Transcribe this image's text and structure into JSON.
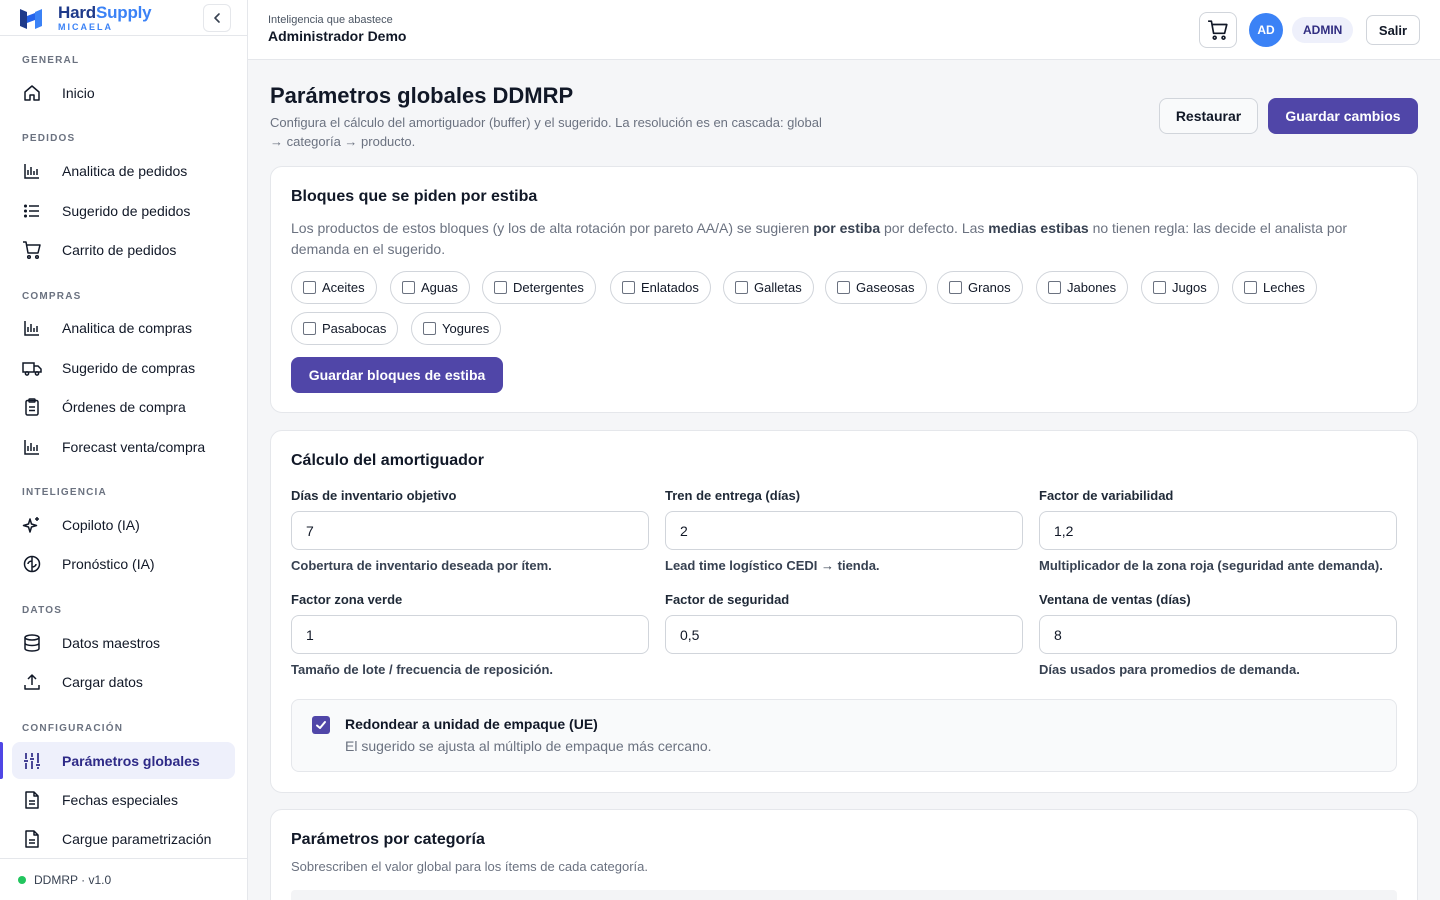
{
  "brand": {
    "name_a": "Hard",
    "name_b": "Supply",
    "sub": "MICAELA"
  },
  "sidebar": {
    "sections": [
      {
        "title": "GENERAL",
        "items": [
          {
            "label": "Inicio",
            "icon": "home-icon"
          }
        ]
      },
      {
        "title": "PEDIDOS",
        "items": [
          {
            "label": "Analitica de pedidos",
            "icon": "bar-chart-icon"
          },
          {
            "label": "Sugerido de pedidos",
            "icon": "list-icon"
          },
          {
            "label": "Carrito de pedidos",
            "icon": "cart-icon"
          }
        ]
      },
      {
        "title": "COMPRAS",
        "items": [
          {
            "label": "Analitica de compras",
            "icon": "bar-chart-icon"
          },
          {
            "label": "Sugerido de compras",
            "icon": "truck-icon"
          },
          {
            "label": "Órdenes de compra",
            "icon": "clipboard-icon"
          },
          {
            "label": "Forecast venta/compra",
            "icon": "bar-chart-icon"
          }
        ]
      },
      {
        "title": "INTELIGENCIA",
        "items": [
          {
            "label": "Copiloto (IA)",
            "icon": "sparkles-icon"
          },
          {
            "label": "Pronóstico (IA)",
            "icon": "brain-icon"
          }
        ]
      },
      {
        "title": "DATOS",
        "items": [
          {
            "label": "Datos maestros",
            "icon": "database-icon"
          },
          {
            "label": "Cargar datos",
            "icon": "upload-icon"
          }
        ]
      },
      {
        "title": "CONFIGURACIÓN",
        "items": [
          {
            "label": "Parámetros globales",
            "icon": "sliders-icon"
          },
          {
            "label": "Fechas especiales",
            "icon": "file-icon"
          },
          {
            "label": "Cargue parametrización",
            "icon": "file-icon"
          }
        ]
      }
    ],
    "footer": "DDMRP · v1.0"
  },
  "header": {
    "tagline": "Inteligencia que abastece",
    "user": "Administrador Demo",
    "avatar": "AD",
    "role": "ADMIN",
    "logout": "Salir"
  },
  "page": {
    "title": "Parámetros globales DDMRP",
    "desc": "Configura el cálculo del amortiguador (buffer) y el sugerido. La resolución es en cascada: global → categoría → producto.",
    "restore": "Restaurar",
    "save": "Guardar cambios"
  },
  "stack_card": {
    "title": "Bloques que se piden por estiba",
    "desc_1": "Los productos de estos bloques (y los de alta rotación por pareto AA/A) se sugieren ",
    "desc_b1": "por estiba",
    "desc_2": " por defecto. Las ",
    "desc_b2": "medias estibas",
    "desc_3": " no tienen regla: las decide el analista por demanda en el sugerido.",
    "blocks": [
      "Aceites",
      "Aguas",
      "Detergentes",
      "Enlatados",
      "Galletas",
      "Gaseosas",
      "Granos",
      "Jabones",
      "Jugos",
      "Leches",
      "Pasabocas",
      "Yogures"
    ],
    "save": "Guardar bloques de estiba"
  },
  "buffer_card": {
    "title": "Cálculo del amortiguador",
    "fields": [
      {
        "label": "Días de inventario objetivo",
        "value": "7",
        "help": "Cobertura de inventario deseada por ítem."
      },
      {
        "label": "Tren de entrega (días)",
        "value": "2",
        "help": "Lead time logístico CEDI → tienda."
      },
      {
        "label": "Factor de variabilidad",
        "value": "1,2",
        "help": "Multiplicador de la zona roja (seguridad ante demanda)."
      },
      {
        "label": "Factor zona verde",
        "value": "1",
        "help": "Tamaño de lote / frecuencia de reposición."
      },
      {
        "label": "Factor de seguridad",
        "value": "0,5",
        "help": ""
      },
      {
        "label": "Ventana de ventas (días)",
        "value": "8",
        "help": "Días usados para promedios de demanda."
      }
    ],
    "round_title": "Redondear a unidad de empaque (UE)",
    "round_desc": "El sugerido se ajusta al múltiplo de empaque más cercano."
  },
  "category_card": {
    "title": "Parámetros por categoría",
    "desc": "Sobrescriben el valor global para los ítems de cada categoría."
  }
}
